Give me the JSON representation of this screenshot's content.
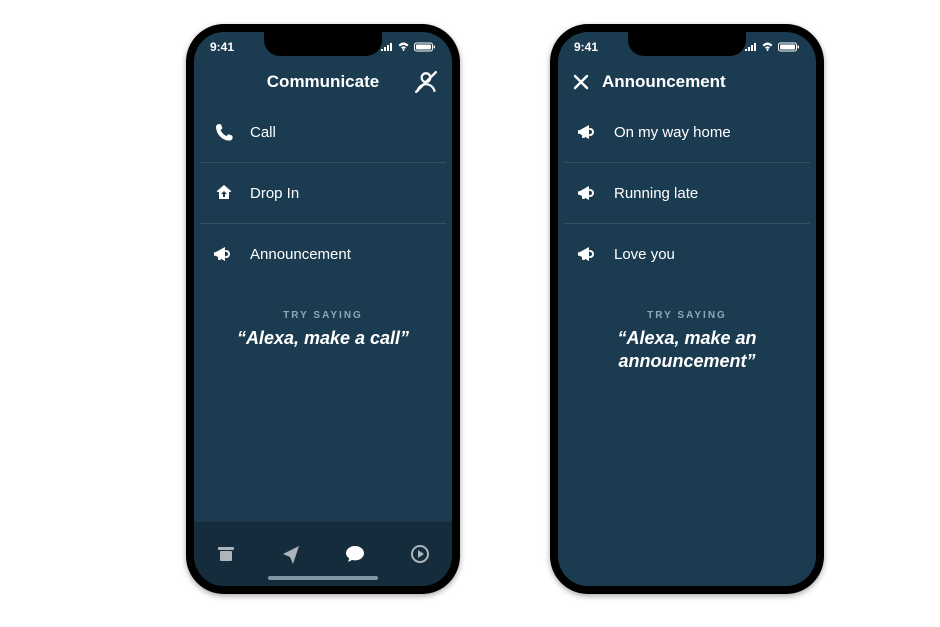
{
  "status": {
    "time": "9:41"
  },
  "left": {
    "title": "Communicate",
    "items": [
      {
        "id": "call",
        "label": "Call",
        "icon": "phone-icon"
      },
      {
        "id": "dropin",
        "label": "Drop In",
        "icon": "dropin-icon"
      },
      {
        "id": "announcement",
        "label": "Announcement",
        "icon": "megaphone-icon"
      }
    ],
    "try_label": "TRY SAYING",
    "try_phrase": "“Alexa, make a call”"
  },
  "right": {
    "title": "Announcement",
    "items": [
      {
        "id": "way",
        "label": "On my way home",
        "icon": "megaphone-icon"
      },
      {
        "id": "late",
        "label": "Running late",
        "icon": "megaphone-icon"
      },
      {
        "id": "love",
        "label": "Love you",
        "icon": "megaphone-icon"
      }
    ],
    "try_label": "TRY SAYING",
    "try_phrase": "“Alexa, make an announcement”"
  }
}
